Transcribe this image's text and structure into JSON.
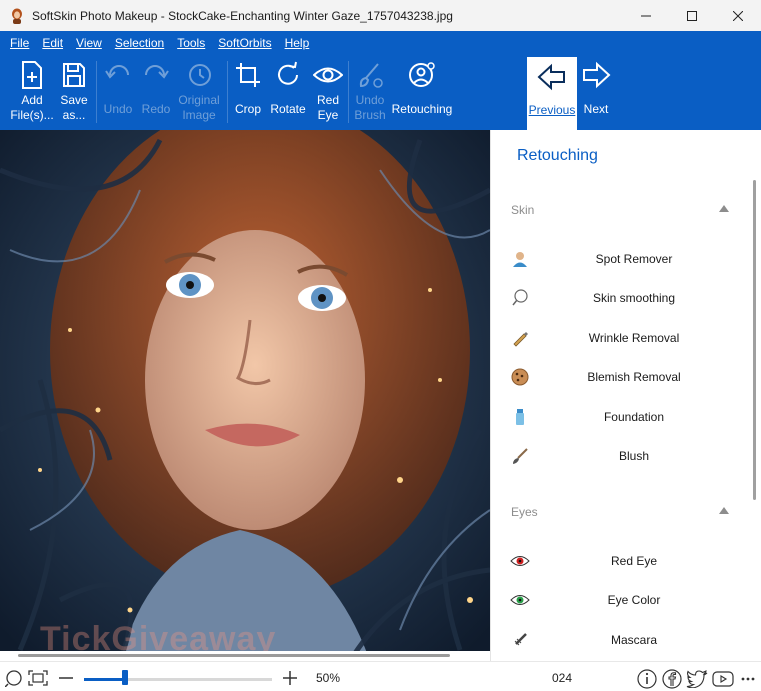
{
  "window": {
    "title": "SoftSkin Photo Makeup - StockCake-Enchanting Winter Gaze_1757043238.jpg",
    "controls": [
      "minimize-icon",
      "maximize-icon",
      "close-icon"
    ]
  },
  "menu": [
    {
      "label": "File"
    },
    {
      "label": "Edit"
    },
    {
      "label": "View"
    },
    {
      "label": "Selection"
    },
    {
      "label": "Tools"
    },
    {
      "label": "SoftOrbits"
    },
    {
      "label": "Help"
    }
  ],
  "toolbar": {
    "add_files": "Add\nFile(s)...",
    "save_as": "Save\nas...",
    "undo": "Undo",
    "redo": "Redo",
    "original_image": "Original\nImage",
    "crop": "Crop",
    "rotate": "Rotate",
    "red_eye": "Red\nEye",
    "undo_brush": "Undo\nBrush",
    "retouching": "Retouching",
    "previous": "Previous",
    "next": "Next"
  },
  "panel": {
    "title": "Retouching",
    "sections": [
      {
        "name": "Skin",
        "items": [
          {
            "label": "Spot Remover",
            "icon": "person-icon"
          },
          {
            "label": "Skin smoothing",
            "icon": "sponge-icon"
          },
          {
            "label": "Wrinkle Removal",
            "icon": "pencil-icon"
          },
          {
            "label": "Blemish Removal",
            "icon": "cookie-icon"
          },
          {
            "label": "Foundation",
            "icon": "bottle-icon"
          },
          {
            "label": "Blush",
            "icon": "brush-icon"
          }
        ]
      },
      {
        "name": "Eyes",
        "items": [
          {
            "label": "Red Eye",
            "icon": "red-eye-icon"
          },
          {
            "label": "Eye Color",
            "icon": "green-eye-icon"
          },
          {
            "label": "Mascara",
            "icon": "mascara-icon"
          }
        ]
      }
    ]
  },
  "canvas": {
    "watermark": "TickGiveaway"
  },
  "statusbar": {
    "zoom_percent": "50%",
    "zoom_level": 0.22,
    "partial_text": "024"
  },
  "colors": {
    "accent": "#0a5ec4",
    "panel_title": "#0a5ec4"
  }
}
